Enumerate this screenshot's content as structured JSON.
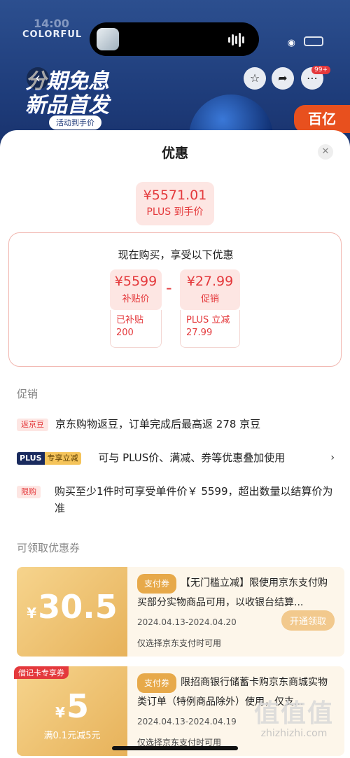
{
  "status_bar": {
    "time": "14:00"
  },
  "background": {
    "brand": "COLORFUL",
    "banner_line1": "分期免息",
    "banner_line2": "新品首发",
    "banner_sub": "活动到手价",
    "badge": "99+",
    "promo_corner": "百亿"
  },
  "sheet": {
    "title": "优惠",
    "final_price": "¥5571.01",
    "final_price_label": "PLUS 到手价",
    "breakdown_title": "现在购买，享受以下优惠",
    "items": [
      {
        "value": "¥5599",
        "label": "补贴价",
        "detail_line1": "已补贴",
        "detail_line2": "200"
      },
      {
        "value": "¥27.99",
        "label": "促销",
        "detail_line1": "PLUS 立减",
        "detail_line2": "27.99"
      }
    ],
    "operator": "-"
  },
  "promotions": {
    "section_label": "促销",
    "rows": [
      {
        "tag": "返京豆",
        "text": "京东购物返豆，订单完成后最高返 278 京豆"
      },
      {
        "tag_a": "PLUS",
        "tag_b": "专享立减",
        "text": "可与 PLUS价、满减、券等优惠叠加使用"
      },
      {
        "tag": "限购",
        "text": "购买至少1件时可享受单件价￥ 5599，超出数量以结算价为准"
      }
    ]
  },
  "coupons": {
    "section_label": "可领取优惠券",
    "items": [
      {
        "currency": "¥",
        "amount": "30.5",
        "condition": "",
        "type": "支付券",
        "description": "【无门槛立减】限使用京东支付购买部分实物商品可用，以收银台结算...",
        "date": "2024.04.13-2024.04.20",
        "note": "仅选择京东支付时可用",
        "button": "开通领取"
      },
      {
        "corner_tag": "借记卡专享券",
        "currency": "¥",
        "amount": "5",
        "condition": "满0.1元减5元",
        "type": "支付券",
        "description": "限招商银行储蓄卡购京东商城实物类订单（特例商品除外）使用，仅支...",
        "date": "2024.04.13-2024.04.19",
        "note": "仅选择京东支付时可用"
      }
    ]
  },
  "watermark": {
    "logo": "值值值",
    "url": "zhizhizhi.com"
  },
  "colors": {
    "accent_red": "#e4393c",
    "coupon_gold": "#e7b25a",
    "plus_navy": "#1a2b5e"
  }
}
